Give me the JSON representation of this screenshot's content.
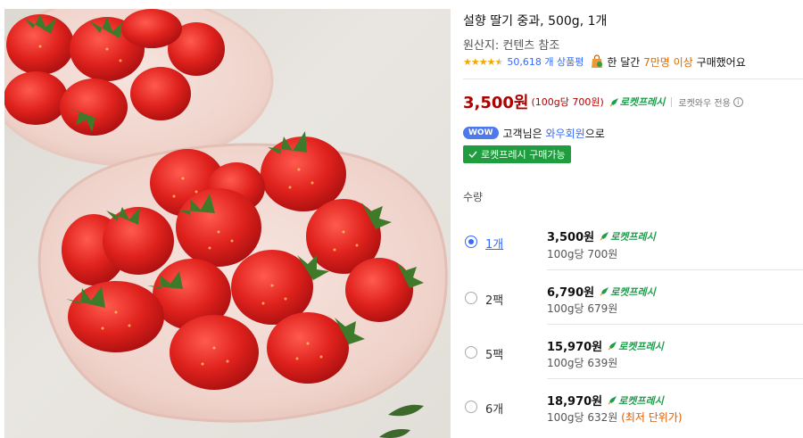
{
  "product": {
    "title": "설향 딸기 중과, 500g, 1개",
    "origin": "원산지: 컨텐츠 참조",
    "rating": 4.5,
    "review_count": "50,618 개 상품평",
    "buy_prefix": "한 달간",
    "buy_highlight": "7만명 이상",
    "buy_suffix": "구매했어요"
  },
  "price": {
    "amount": "3,500원",
    "unit": "(100g당 700원)",
    "rocket_label": "로켓프레시",
    "wow_only": "로켓와우 전용",
    "info_glyph": "i"
  },
  "membership": {
    "badge": "WOW",
    "text_prefix": "고객님은",
    "link": "와우회원",
    "text_suffix": "으로"
  },
  "fresh_badge": "로켓프레시 구매가능",
  "quantity_label": "수량",
  "options": [
    {
      "name": "1개",
      "price": "3,500원",
      "unit": "100g당 700원",
      "note": "",
      "selected": true
    },
    {
      "name": "2팩",
      "price": "6,790원",
      "unit": "100g당 679원",
      "note": "",
      "selected": false
    },
    {
      "name": "5팩",
      "price": "15,970원",
      "unit": "100g당 639원",
      "note": "",
      "selected": false
    },
    {
      "name": "6개",
      "price": "18,970원",
      "unit": "100g당 632원",
      "note": "(최저 단위가)",
      "selected": false
    }
  ],
  "colors": {
    "price_red": "#ae0000",
    "rocket_green": "#1a9e4a",
    "link_blue": "#346aff",
    "star_gold": "#f2a900",
    "badge_green": "#1f9d3f"
  },
  "icons": [
    "star-icon",
    "shopping-bag-icon",
    "rocket-icon",
    "info-icon",
    "check-icon",
    "radio-icon"
  ]
}
